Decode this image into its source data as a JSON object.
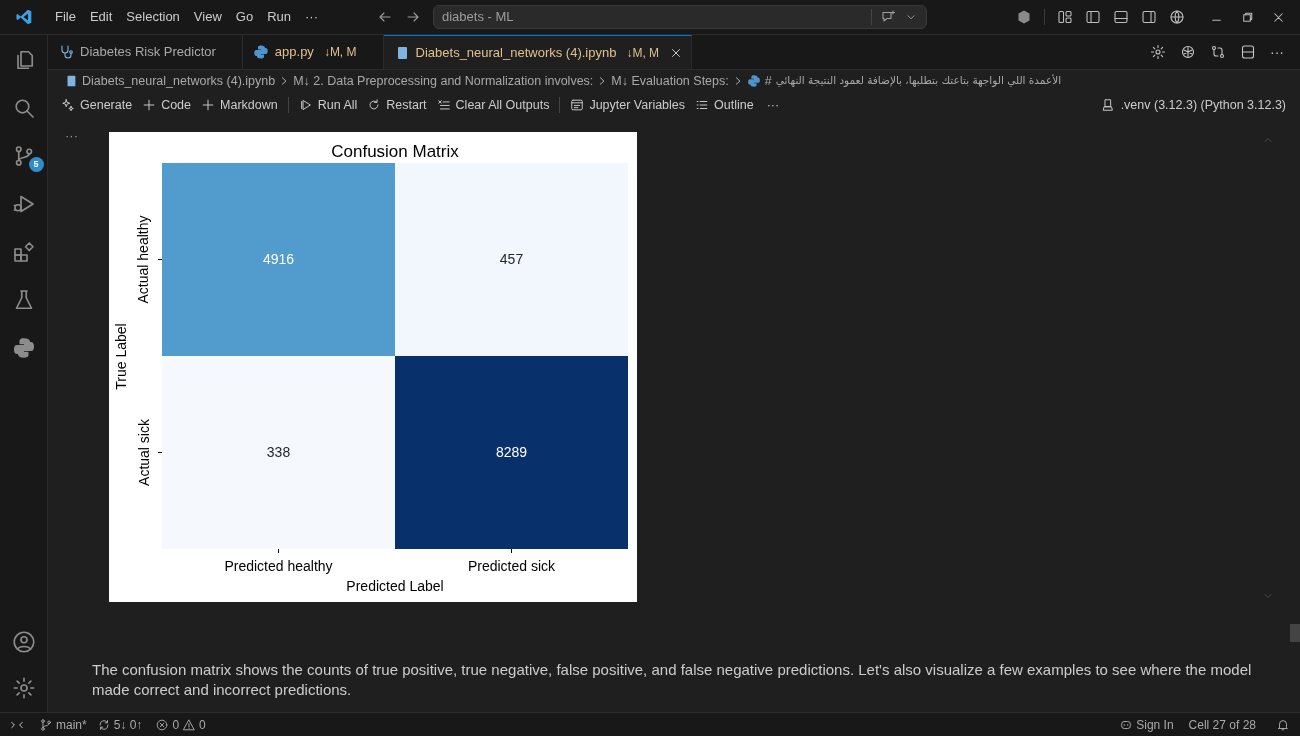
{
  "menu": [
    "File",
    "Edit",
    "Selection",
    "View",
    "Go",
    "Run",
    "···"
  ],
  "command_center": "diabets - ML",
  "activity_bar": {
    "source_control_badge": "5"
  },
  "tabs": [
    {
      "label": "Diabetes Risk Predictor",
      "kind": "webview",
      "selected": false
    },
    {
      "label": "app.py",
      "badge": "↓M, M",
      "kind": "python",
      "selected": false
    },
    {
      "label": "Diabets_neural_networks (4).ipynb",
      "badge": "↓M, M",
      "kind": "notebook",
      "selected": true
    }
  ],
  "breadcrumb": [
    {
      "label": "Diabets_neural_networks (4).ipynb",
      "kind": "notebook"
    },
    {
      "label": "M↓ 2. Data Preprocessing and Normalization involves:",
      "kind": "text"
    },
    {
      "label": "M↓ Evaluation Steps:",
      "kind": "text"
    },
    {
      "label": "#",
      "kind": "python"
    },
    {
      "label": "الأعمدة اللي الواجهة بتاعتك بتطلبها، بالإضافة لعمود النتيجة النهائي",
      "kind": "rtl"
    }
  ],
  "toolbar": [
    {
      "label": "Generate",
      "kind": "sparkle"
    },
    {
      "label": "Code",
      "kind": "plus"
    },
    {
      "label": "Markdown",
      "kind": "plus"
    },
    {
      "kind": "divider"
    },
    {
      "label": "Run All",
      "kind": "run"
    },
    {
      "label": "Restart",
      "kind": "restart"
    },
    {
      "label": "Clear All Outputs",
      "kind": "clear"
    },
    {
      "kind": "divider"
    },
    {
      "label": "Jupyter Variables",
      "kind": "variables"
    },
    {
      "label": "Outline",
      "kind": "outline"
    },
    {
      "label": "···",
      "kind": "more"
    }
  ],
  "kernel": ".venv (3.12.3) (Python 3.12.3)",
  "cell_menu": "···",
  "confusion_matrix": {
    "title": "Confusion Matrix",
    "y_axis": {
      "label": "True Label",
      "ticks": [
        "Actual healthy",
        "Actual sick"
      ]
    },
    "matrix": [
      [
        {
          "value": "4916",
          "color": "#519ccc"
        },
        {
          "value": "457",
          "color": "#f2f7fd"
        }
      ],
      [
        {
          "value": "338",
          "color": "#f5f9fe"
        },
        {
          "value": "8289",
          "color": "#08306b"
        }
      ]
    ],
    "x_axis": {
      "label": "Predicted Label",
      "ticks": [
        "Predicted healthy",
        "Predicted sick"
      ]
    }
  },
  "markdown": "The confusion matrix shows the counts of true positive, true negative, false positive, and false negative predictions. Let's also visualize a few examples to see where the model made correct and incorrect predictions.",
  "status_bar": {
    "branch": "main*",
    "sync": "5↓ 0↑",
    "errors": "0",
    "warnings": "0",
    "sign_in": "Sign In",
    "cell": "Cell 27 of 28"
  }
}
